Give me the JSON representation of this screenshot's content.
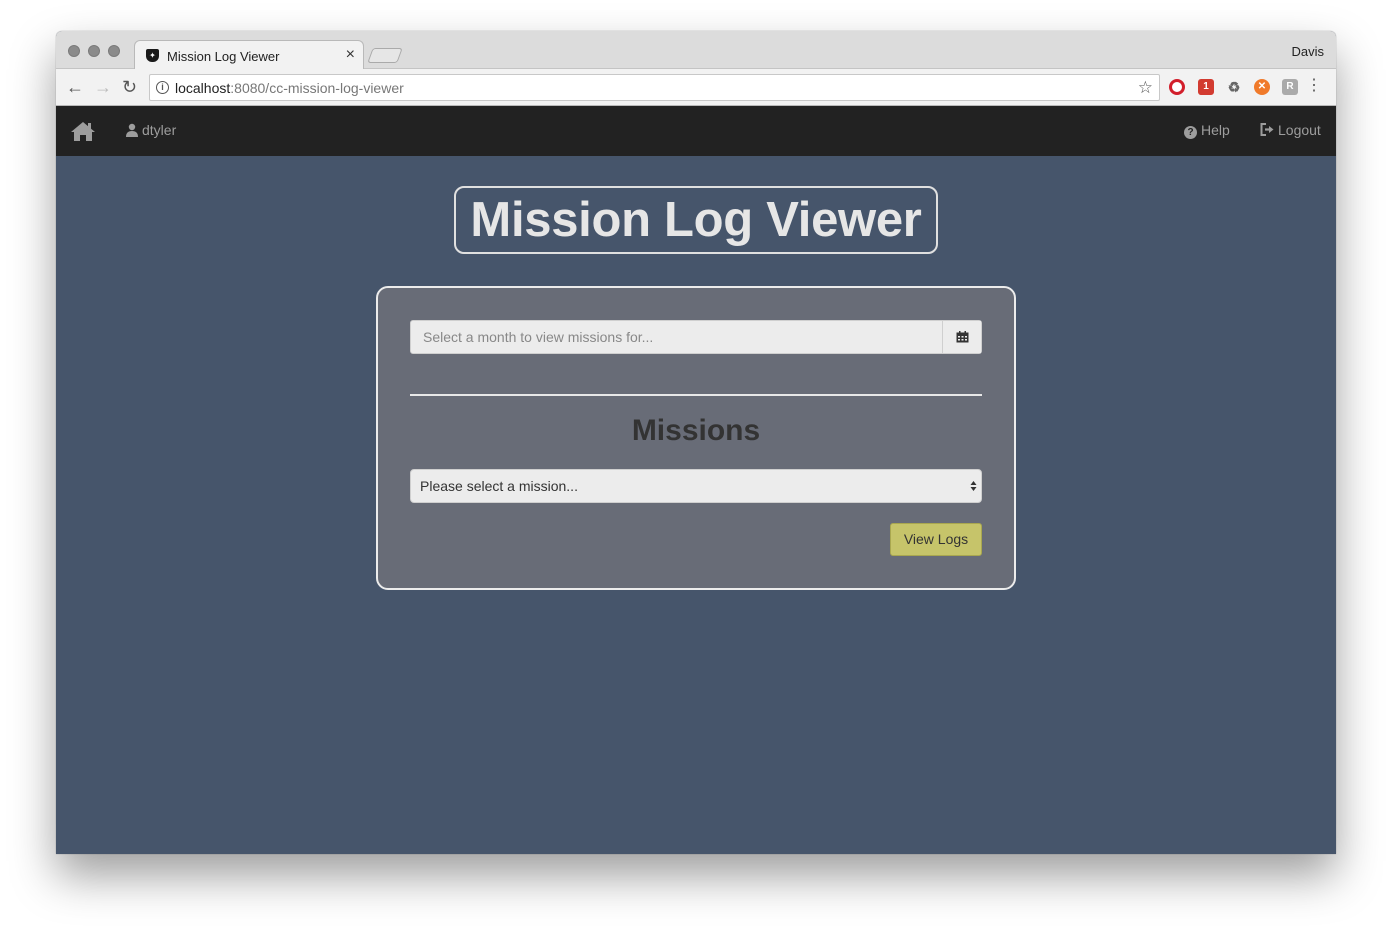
{
  "browser": {
    "tab_title": "Mission Log Viewer",
    "tab_close": "×",
    "profile_name": "Davis",
    "url_host": "localhost",
    "url_rest": ":8080/cc-mission-log-viewer"
  },
  "nav": {
    "user": "dtyler",
    "help": "Help",
    "logout": "Logout"
  },
  "main": {
    "title": "Mission Log Viewer",
    "month_placeholder": "Select a month to view missions for...",
    "missions_heading": "Missions",
    "mission_select_value": "Please select a mission...",
    "view_logs_label": "View Logs"
  },
  "colors": {
    "navbar": "#222222",
    "page_bg": "#46556b",
    "panel_bg": "#686c77",
    "button": "#c6c46a"
  }
}
